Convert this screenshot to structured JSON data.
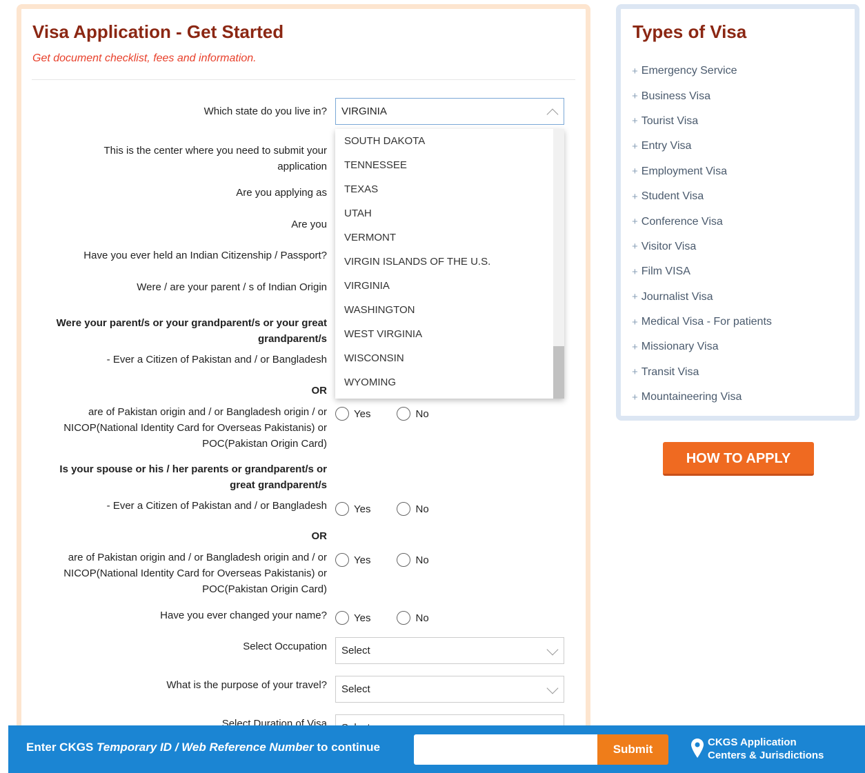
{
  "form": {
    "title": "Visa Application - Get Started",
    "subtitle": "Get document checklist, fees and information.",
    "state_label": "Which state do you live in?",
    "state_value": "VIRGINIA",
    "center_label_1": "This is the center where you need to submit your",
    "center_label_2": "application",
    "applying_as_label": "Are you applying as",
    "are_you_label": "Are you",
    "citizenship_label": "Have you ever held an Indian Citizenship / Passport?",
    "parent_origin_label": "Were / are your parent / s of Indian Origin",
    "grandparents_heading_1": "Were your parent/s or your grandparent/s or your great",
    "grandparents_heading_2": "grandparent/s",
    "citizen_pak_label": "- Ever a Citizen of Pakistan and / or Bangladesh",
    "or_label": "OR",
    "pak_origin_1": "are of Pakistan origin and / or Bangladesh origin / or",
    "pak_origin_2": "NICOP(National Identity Card for Overseas Pakistanis) or",
    "pak_origin_3": "POC(Pakistan Origin Card)",
    "spouse_heading_1": "Is your spouse or his / her parents or grandparent/s or",
    "spouse_heading_2": "great grandparent/s",
    "spouse_citizen_label": "- Ever a Citizen of Pakistan and / or Bangladesh",
    "spouse_or_label": "OR",
    "spouse_origin_1": "are of Pakistan origin and / or Bangladesh origin and / or",
    "spouse_origin_2": "NICOP(National Identity Card for Overseas Pakistanis) or",
    "spouse_origin_3": "POC(Pakistan Origin Card)",
    "name_change_label": "Have you ever changed your name?",
    "occupation_label": "Select Occupation",
    "occupation_value": "Select",
    "purpose_label": "What is the purpose of your travel?",
    "purpose_value": "Select",
    "duration_label": "Select Duration of Visa",
    "duration_value": "Select",
    "yes_label": "Yes",
    "no_label": "No"
  },
  "state_dropdown": {
    "options": [
      "SOUTH DAKOTA",
      "TENNESSEE",
      "TEXAS",
      "UTAH",
      "VERMONT",
      "VIRGIN ISLANDS OF THE U.S.",
      "VIRGINIA",
      "WASHINGTON",
      "WEST VIRGINIA",
      "WISCONSIN",
      "WYOMING"
    ]
  },
  "types": {
    "title": "Types of Visa",
    "items": [
      "Emergency Service",
      "Business Visa",
      "Tourist Visa",
      "Entry Visa",
      "Employment Visa",
      "Student Visa",
      "Conference Visa",
      "Visitor Visa",
      "Film VISA",
      "Journalist Visa",
      "Medical Visa - For patients",
      "Missionary Visa",
      "Transit Visa",
      "Mountaineering Visa"
    ]
  },
  "how_to_apply": "HOW TO APPLY",
  "bottom_bar": {
    "text_prefix": "Enter CKGS ",
    "text_italic": "Temporary ID / Web Reference Number",
    "text_suffix": " to continue",
    "submit": "Submit",
    "centers_1": "CKGS Application",
    "centers_2": "Centers & Jurisdictions"
  },
  "colors": {
    "title": "#8b2713",
    "accent": "#ef6a21",
    "bar": "#1b85d3"
  }
}
